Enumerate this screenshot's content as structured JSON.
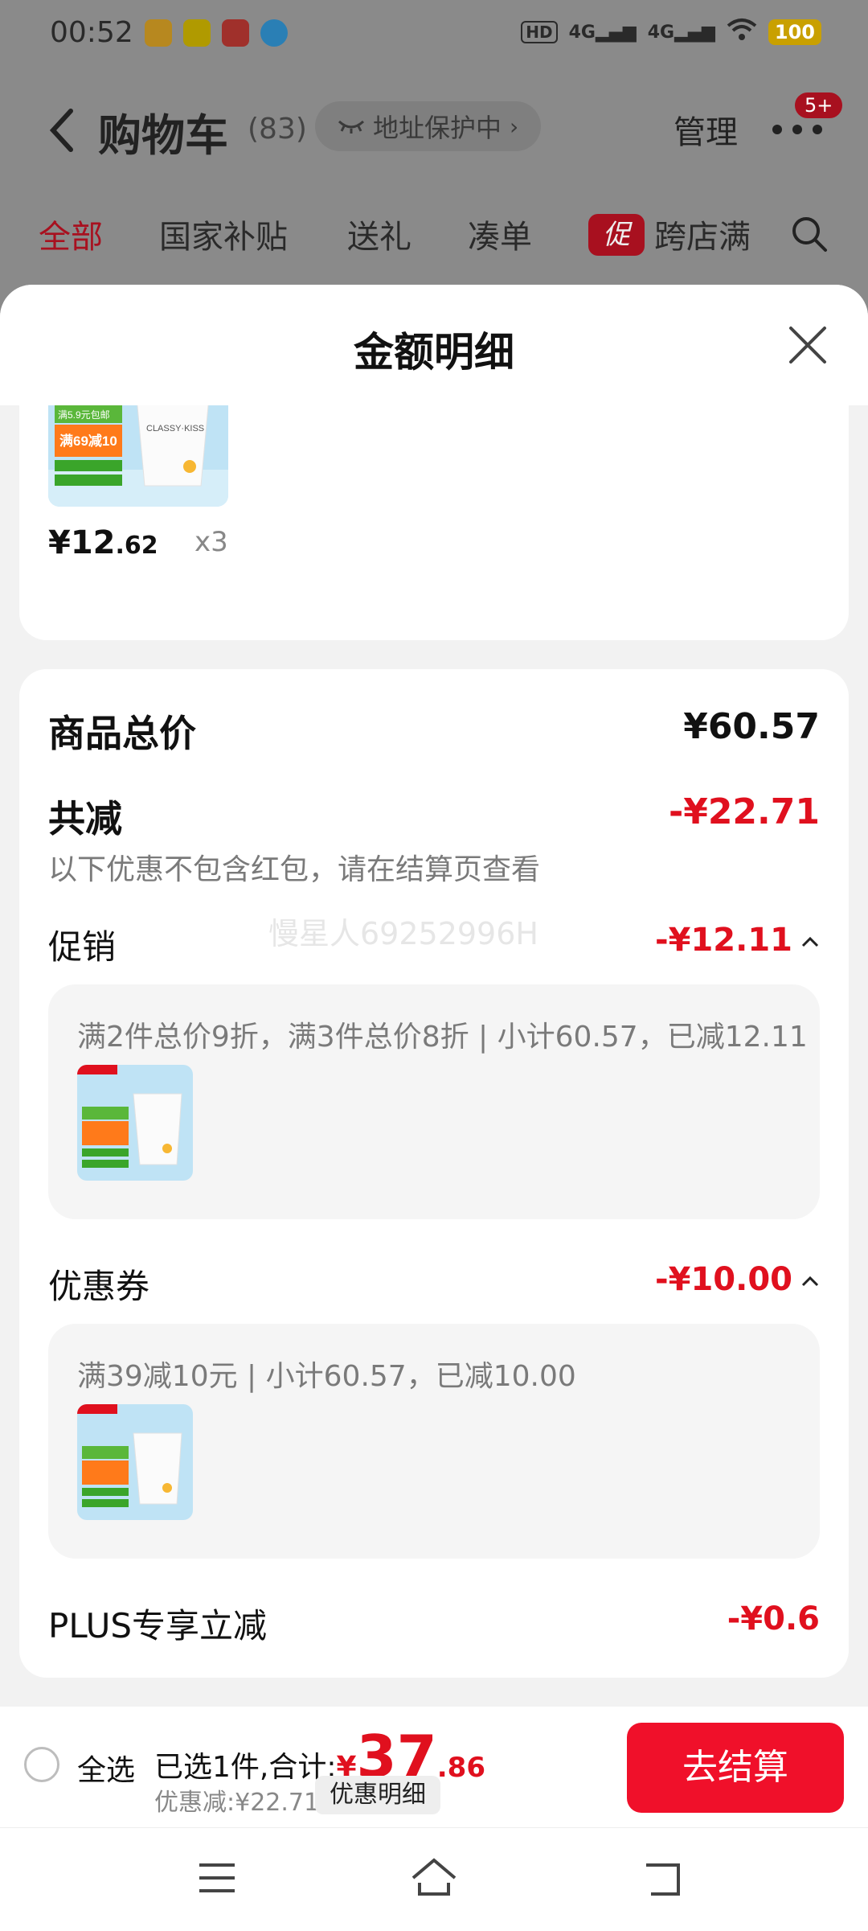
{
  "status_bar": {
    "time": "00:52",
    "network_1": "4G",
    "network_2": "4G",
    "battery": "100",
    "hd": "HD",
    "app_icon_colors": [
      "#f5b72a",
      "#f3d400",
      "#e0322e",
      "#1aa3f0"
    ]
  },
  "nav": {
    "title": "购物车",
    "count": "(83)",
    "address_protect": "地址保护中",
    "manage": "管理",
    "more_badge": "5+"
  },
  "tabs": [
    {
      "label": "全部",
      "active": true
    },
    {
      "label": "国家补贴"
    },
    {
      "label": "送礼"
    },
    {
      "label": "凑单"
    },
    {
      "label": "跨店满"
    }
  ],
  "promo_badge": "促",
  "sheet": {
    "title": "金额明细"
  },
  "item": {
    "price_int": "¥12",
    "price_dec": ".62",
    "qty": "x3",
    "image_text": {
      "brand": "CLASSY·KISS",
      "ribbon": "满5.9元包邮",
      "deal": "满69减10"
    }
  },
  "summary": {
    "total_label": "商品总价",
    "total_value": "¥60.57",
    "reduce_label": "共减",
    "reduce_value": "-¥22.71",
    "reduce_note": "以下优惠不包含红包，请在结算页查看",
    "watermark": "慢星人69252996H",
    "promo_label": "促销",
    "promo_value": "-¥12.11",
    "promo_detail": "满2件总价9折，满3件总价8折 | 小计60.57，已减12.11",
    "coupon_label": "优惠券",
    "coupon_value": "-¥10.00",
    "coupon_detail": "满39减10元 | 小计60.57，已减10.00",
    "plus_label": "PLUS专享立减",
    "plus_value": "-¥0.6"
  },
  "checkout": {
    "select_all": "全选",
    "total_prefix": "已选1件,合计:",
    "yen": "¥",
    "total_int": "37",
    "total_dec": ".86",
    "discount_text": "优惠减:¥22.71",
    "detail_button": "优惠明细",
    "checkout_button": "去结算"
  },
  "colors": {
    "accent_red": "#e0101e",
    "button_red": "#f0102a"
  }
}
